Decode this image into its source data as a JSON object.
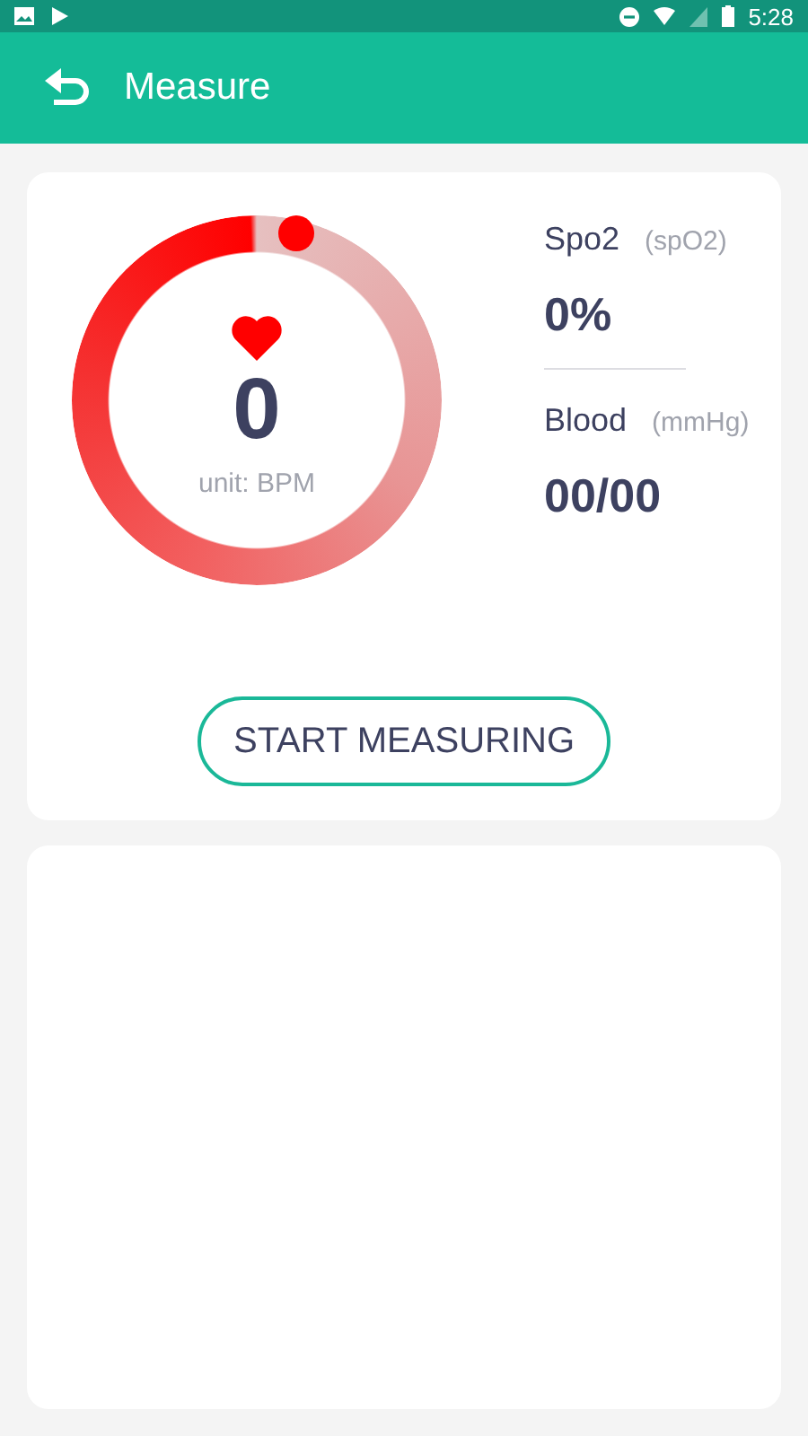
{
  "status_bar": {
    "time": "5:28"
  },
  "app_bar": {
    "title": "Measure"
  },
  "heart_rate": {
    "value": "0",
    "unit": "unit: BPM"
  },
  "readings": [
    {
      "label": "Spo2",
      "unit": "(spO2)",
      "value": "0%"
    },
    {
      "label": "Blood",
      "unit": "(mmHg)",
      "value": "00/00"
    }
  ],
  "button": {
    "label": "START MEASURING"
  }
}
